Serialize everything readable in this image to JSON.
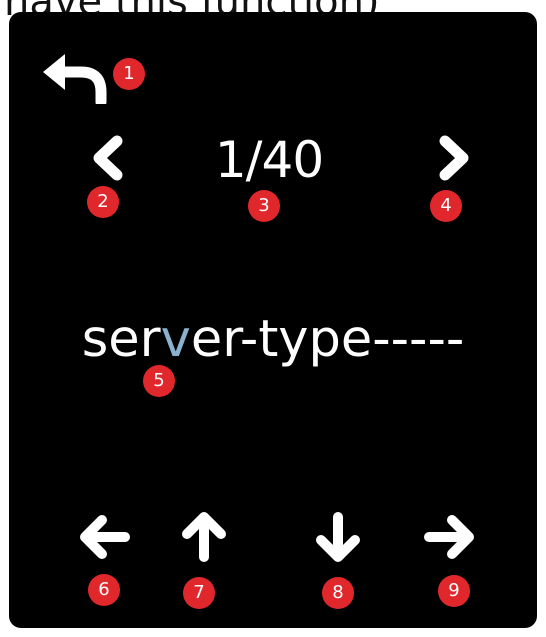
{
  "caption": "have this function)",
  "counter": {
    "current": "1",
    "separator": "/",
    "total": "40"
  },
  "word": {
    "before": "ser",
    "highlight": "v",
    "after": "er-type-----"
  },
  "badges": [
    "1",
    "2",
    "3",
    "4",
    "5",
    "6",
    "7",
    "8",
    "9"
  ],
  "icons": {
    "back": "undo-arrow-icon",
    "prev": "chevron-left-icon",
    "next": "chevron-right-icon",
    "left": "arrow-left-icon",
    "up": "arrow-up-icon",
    "down": "arrow-down-icon",
    "right": "arrow-right-icon"
  },
  "colors": {
    "screen_bg": "#000000",
    "icon": "#ffffff",
    "highlight": "#8ab2cf",
    "badge": "#e0282c"
  }
}
